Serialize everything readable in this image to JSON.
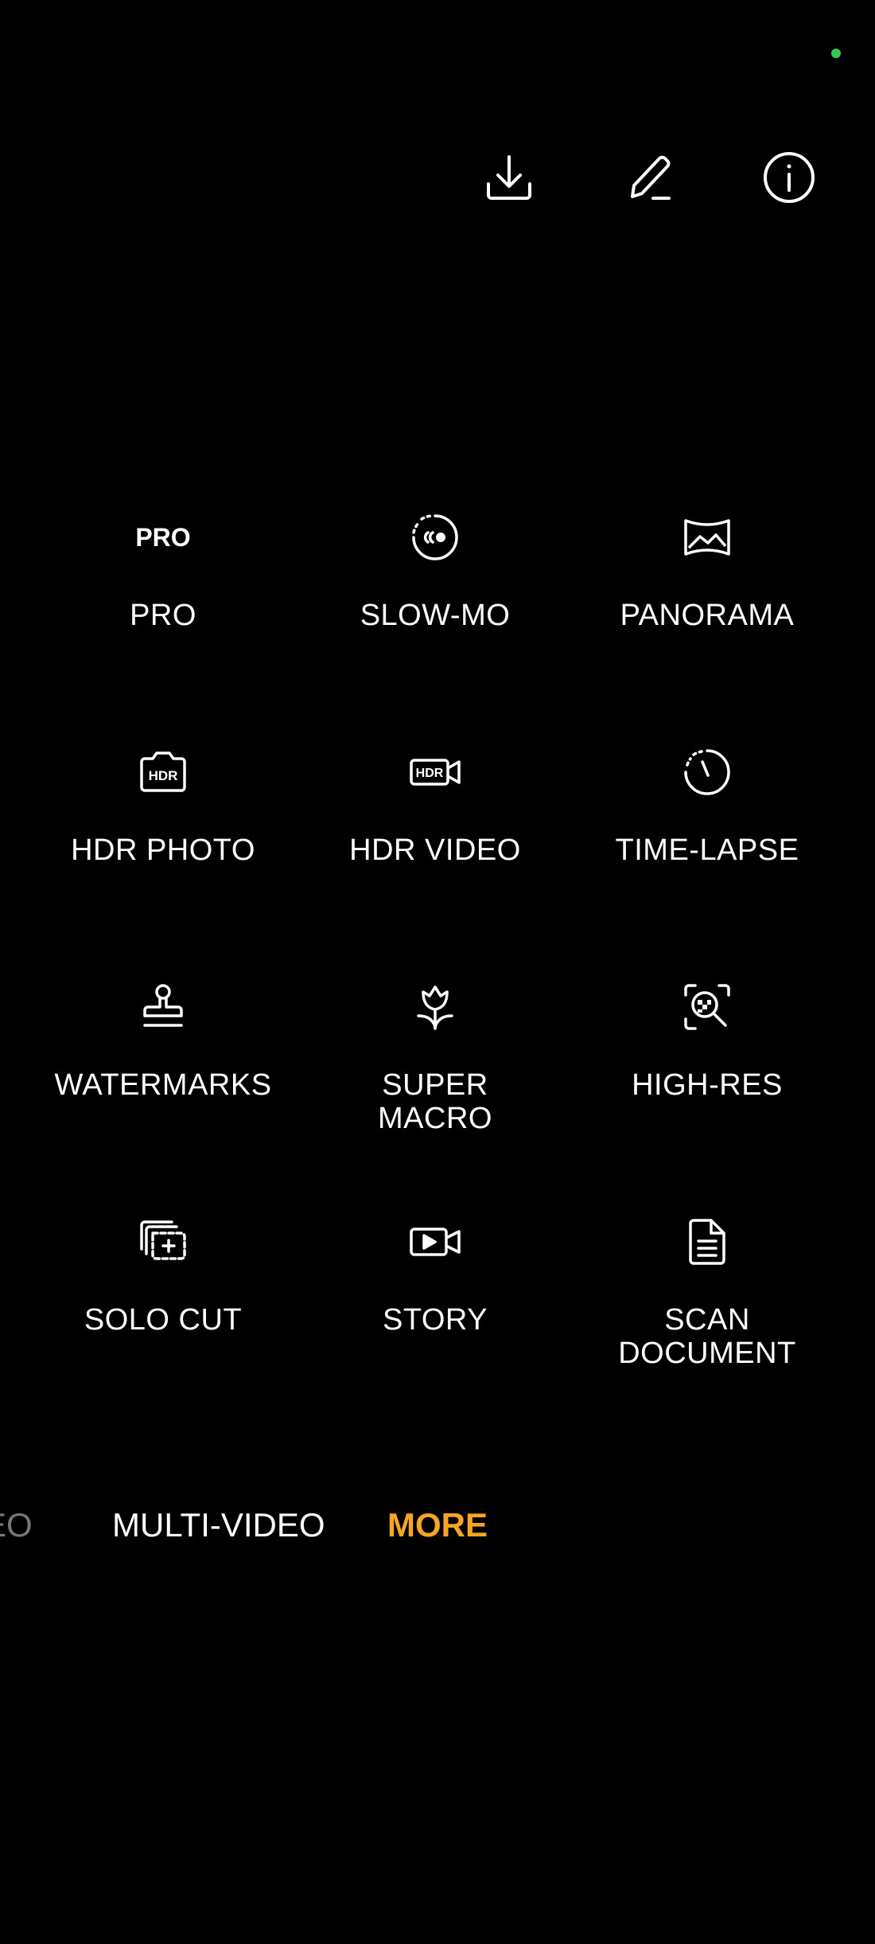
{
  "status": {
    "indicator_color": "#34c759"
  },
  "toolbar": {
    "download_icon": "download-icon",
    "edit_icon": "pencil-icon",
    "info_icon": "info-icon"
  },
  "modes": [
    {
      "label": "PRO",
      "icon": "pro-icon",
      "icon_text": "PRO"
    },
    {
      "label": "SLOW-MO",
      "icon": "slow-mo-icon"
    },
    {
      "label": "PANORAMA",
      "icon": "panorama-icon"
    },
    {
      "label": "HDR PHOTO",
      "icon": "hdr-photo-icon",
      "icon_text": "HDR"
    },
    {
      "label": "HDR VIDEO",
      "icon": "hdr-video-icon",
      "icon_text": "HDR"
    },
    {
      "label": "TIME-LAPSE",
      "icon": "time-lapse-icon"
    },
    {
      "label": "WATERMARKS",
      "icon": "stamp-icon"
    },
    {
      "label": "SUPER\nMACRO",
      "icon": "flower-icon"
    },
    {
      "label": "HIGH-RES",
      "icon": "high-res-icon"
    },
    {
      "label": "SOLO CUT",
      "icon": "solo-cut-icon"
    },
    {
      "label": "STORY",
      "icon": "story-icon"
    },
    {
      "label": "SCAN\nDOCUMENT",
      "icon": "document-icon"
    }
  ],
  "mode_bar": {
    "partial_label": "EO",
    "items": [
      "MULTI-VIDEO",
      "MORE"
    ],
    "active": "MORE",
    "active_color": "#f5a623"
  }
}
